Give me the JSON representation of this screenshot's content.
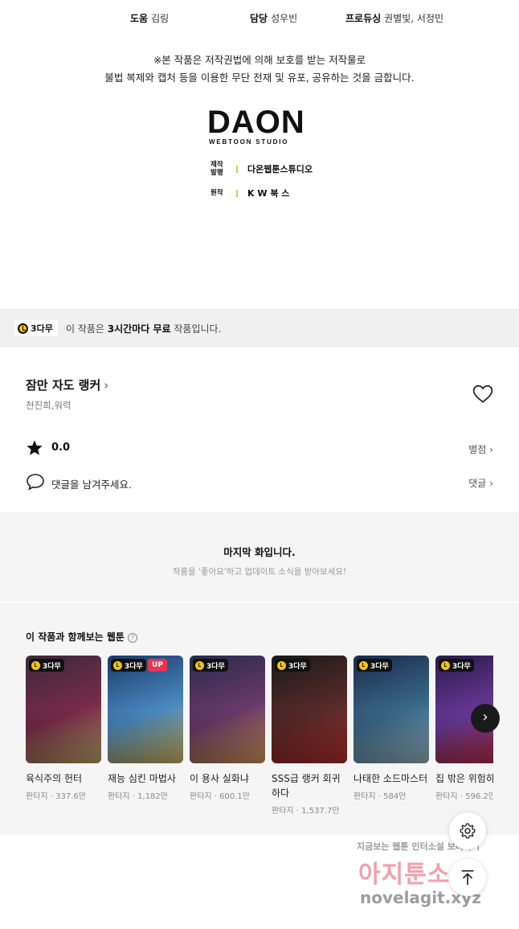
{
  "credits": [
    {
      "role": "도움",
      "name": "김링"
    },
    {
      "role": "담당",
      "name": "성우빈"
    },
    {
      "role": "프로듀싱",
      "name": "권별빛, 서정민"
    }
  ],
  "notice": {
    "line1": "※본 작품은 저작권법에 의해 보호를 받는 저작물로",
    "line2": "불법 복제와 캡처 등을 이용한 무단 전재 및 유포, 공유하는 것을 금합니다."
  },
  "logo": {
    "big": "DAON",
    "small": "WEBTOON STUDIO"
  },
  "production": [
    {
      "key": "제작\n발행",
      "value": "다온웹툰스튜디오"
    },
    {
      "key": "원작",
      "value": "K W 북 스"
    }
  ],
  "banner": {
    "badge": "3다무",
    "text_pre": "이 작품은 ",
    "text_bold": "3시간마다 무료",
    "text_post": " 작품입니다."
  },
  "work": {
    "title": "잠만 자도 랭커",
    "title_chevron": "›",
    "authors": "천진희,워력",
    "rating": "0.0",
    "rating_link": "별점",
    "comment_prompt": "댓글을 남겨주세요.",
    "comment_link": "댓글",
    "link_chevron": "›"
  },
  "last_episode": {
    "heading": "마지막 화입니다.",
    "sub": "작품을 '좋아요'하고 업데이트 소식을 받아보세요!"
  },
  "recommend": {
    "title": "이 작품과 함께보는 웹툰",
    "help": "?",
    "next": "›",
    "items": [
      {
        "badge": "3다무",
        "up": "",
        "name": "육식주의 헌터",
        "genre": "판타지",
        "views": "337.6만",
        "c1": "#3a2a3a",
        "c2": "#7a2a4a",
        "c3": "#c8b070"
      },
      {
        "badge": "3다무",
        "up": "UP",
        "name": "재능 심킨 마법사",
        "genre": "판타지",
        "views": "1,182만",
        "c1": "#1a3a6a",
        "c2": "#4a8ac0",
        "c3": "#e0c060"
      },
      {
        "badge": "3다무",
        "up": "",
        "name": "이 용사 실화냐",
        "genre": "판타지",
        "views": "600.1만",
        "c1": "#2a2a4a",
        "c2": "#6a3a6a",
        "c3": "#e0a060"
      },
      {
        "badge": "3다무",
        "up": "",
        "name": "SSS급 랭커 회귀하다",
        "genre": "판타지",
        "views": "1,537.7만",
        "c1": "#1a1a1a",
        "c2": "#5a2a2a",
        "c3": "#c03030"
      },
      {
        "badge": "3다무",
        "up": "",
        "name": "나태한 소드마스터",
        "genre": "판타지",
        "views": "584만",
        "c1": "#1a2a4a",
        "c2": "#3a6a8a",
        "c3": "#a0c0d0"
      },
      {
        "badge": "3다무",
        "up": "",
        "name": "집 밖은 위험하",
        "genre": "판타지",
        "views": "596.2만",
        "c1": "#2a1a4a",
        "c2": "#6a3a9a",
        "c3": "#d03040"
      }
    ]
  },
  "watermark": {
    "line1": "지금보는 웹툰 인터소설 보러가기",
    "line2": "아지툰소설",
    "line3": "novelagit.xyz"
  },
  "colors": {
    "accent_yellow": "#f5c400",
    "up_red": "#e8344e",
    "banner_bg": "#f0f0f0",
    "section_bg": "#f5f5f5"
  },
  "icons": [
    "clock-icon",
    "heart-icon",
    "star-icon",
    "comment-icon",
    "help-icon",
    "chevron-right-icon",
    "settings-icon",
    "arrow-up-icon"
  ]
}
